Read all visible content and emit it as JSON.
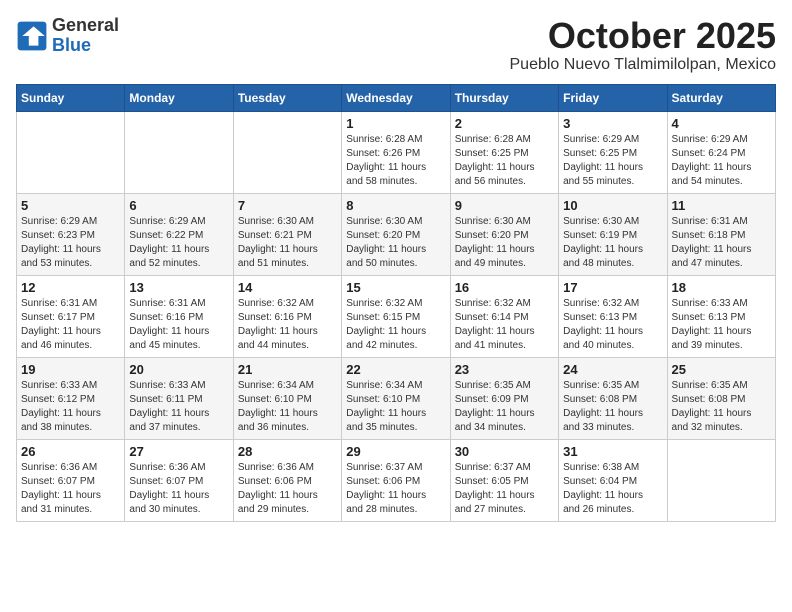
{
  "logo": {
    "general": "General",
    "blue": "Blue"
  },
  "header": {
    "month": "October 2025",
    "location": "Pueblo Nuevo Tlalmimilolpan, Mexico"
  },
  "weekdays": [
    "Sunday",
    "Monday",
    "Tuesday",
    "Wednesday",
    "Thursday",
    "Friday",
    "Saturday"
  ],
  "weeks": [
    [
      {
        "day": "",
        "info": ""
      },
      {
        "day": "",
        "info": ""
      },
      {
        "day": "",
        "info": ""
      },
      {
        "day": "1",
        "info": "Sunrise: 6:28 AM\nSunset: 6:26 PM\nDaylight: 11 hours\nand 58 minutes."
      },
      {
        "day": "2",
        "info": "Sunrise: 6:28 AM\nSunset: 6:25 PM\nDaylight: 11 hours\nand 56 minutes."
      },
      {
        "day": "3",
        "info": "Sunrise: 6:29 AM\nSunset: 6:25 PM\nDaylight: 11 hours\nand 55 minutes."
      },
      {
        "day": "4",
        "info": "Sunrise: 6:29 AM\nSunset: 6:24 PM\nDaylight: 11 hours\nand 54 minutes."
      }
    ],
    [
      {
        "day": "5",
        "info": "Sunrise: 6:29 AM\nSunset: 6:23 PM\nDaylight: 11 hours\nand 53 minutes."
      },
      {
        "day": "6",
        "info": "Sunrise: 6:29 AM\nSunset: 6:22 PM\nDaylight: 11 hours\nand 52 minutes."
      },
      {
        "day": "7",
        "info": "Sunrise: 6:30 AM\nSunset: 6:21 PM\nDaylight: 11 hours\nand 51 minutes."
      },
      {
        "day": "8",
        "info": "Sunrise: 6:30 AM\nSunset: 6:20 PM\nDaylight: 11 hours\nand 50 minutes."
      },
      {
        "day": "9",
        "info": "Sunrise: 6:30 AM\nSunset: 6:20 PM\nDaylight: 11 hours\nand 49 minutes."
      },
      {
        "day": "10",
        "info": "Sunrise: 6:30 AM\nSunset: 6:19 PM\nDaylight: 11 hours\nand 48 minutes."
      },
      {
        "day": "11",
        "info": "Sunrise: 6:31 AM\nSunset: 6:18 PM\nDaylight: 11 hours\nand 47 minutes."
      }
    ],
    [
      {
        "day": "12",
        "info": "Sunrise: 6:31 AM\nSunset: 6:17 PM\nDaylight: 11 hours\nand 46 minutes."
      },
      {
        "day": "13",
        "info": "Sunrise: 6:31 AM\nSunset: 6:16 PM\nDaylight: 11 hours\nand 45 minutes."
      },
      {
        "day": "14",
        "info": "Sunrise: 6:32 AM\nSunset: 6:16 PM\nDaylight: 11 hours\nand 44 minutes."
      },
      {
        "day": "15",
        "info": "Sunrise: 6:32 AM\nSunset: 6:15 PM\nDaylight: 11 hours\nand 42 minutes."
      },
      {
        "day": "16",
        "info": "Sunrise: 6:32 AM\nSunset: 6:14 PM\nDaylight: 11 hours\nand 41 minutes."
      },
      {
        "day": "17",
        "info": "Sunrise: 6:32 AM\nSunset: 6:13 PM\nDaylight: 11 hours\nand 40 minutes."
      },
      {
        "day": "18",
        "info": "Sunrise: 6:33 AM\nSunset: 6:13 PM\nDaylight: 11 hours\nand 39 minutes."
      }
    ],
    [
      {
        "day": "19",
        "info": "Sunrise: 6:33 AM\nSunset: 6:12 PM\nDaylight: 11 hours\nand 38 minutes."
      },
      {
        "day": "20",
        "info": "Sunrise: 6:33 AM\nSunset: 6:11 PM\nDaylight: 11 hours\nand 37 minutes."
      },
      {
        "day": "21",
        "info": "Sunrise: 6:34 AM\nSunset: 6:10 PM\nDaylight: 11 hours\nand 36 minutes."
      },
      {
        "day": "22",
        "info": "Sunrise: 6:34 AM\nSunset: 6:10 PM\nDaylight: 11 hours\nand 35 minutes."
      },
      {
        "day": "23",
        "info": "Sunrise: 6:35 AM\nSunset: 6:09 PM\nDaylight: 11 hours\nand 34 minutes."
      },
      {
        "day": "24",
        "info": "Sunrise: 6:35 AM\nSunset: 6:08 PM\nDaylight: 11 hours\nand 33 minutes."
      },
      {
        "day": "25",
        "info": "Sunrise: 6:35 AM\nSunset: 6:08 PM\nDaylight: 11 hours\nand 32 minutes."
      }
    ],
    [
      {
        "day": "26",
        "info": "Sunrise: 6:36 AM\nSunset: 6:07 PM\nDaylight: 11 hours\nand 31 minutes."
      },
      {
        "day": "27",
        "info": "Sunrise: 6:36 AM\nSunset: 6:07 PM\nDaylight: 11 hours\nand 30 minutes."
      },
      {
        "day": "28",
        "info": "Sunrise: 6:36 AM\nSunset: 6:06 PM\nDaylight: 11 hours\nand 29 minutes."
      },
      {
        "day": "29",
        "info": "Sunrise: 6:37 AM\nSunset: 6:06 PM\nDaylight: 11 hours\nand 28 minutes."
      },
      {
        "day": "30",
        "info": "Sunrise: 6:37 AM\nSunset: 6:05 PM\nDaylight: 11 hours\nand 27 minutes."
      },
      {
        "day": "31",
        "info": "Sunrise: 6:38 AM\nSunset: 6:04 PM\nDaylight: 11 hours\nand 26 minutes."
      },
      {
        "day": "",
        "info": ""
      }
    ]
  ]
}
